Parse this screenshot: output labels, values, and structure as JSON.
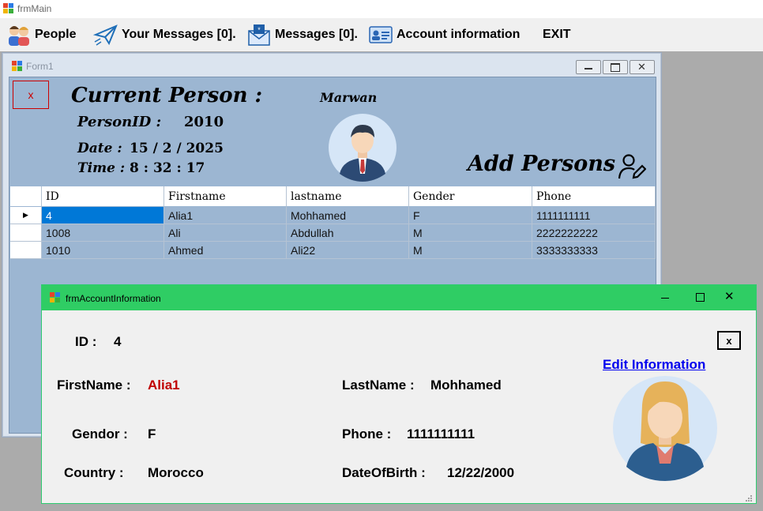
{
  "main_window": {
    "title": "frmMain"
  },
  "menu": {
    "people": "People",
    "your_messages": "Your Messages [0].",
    "messages": "Messages [0].",
    "account_information": "Account information",
    "exit": "EXIT"
  },
  "form1": {
    "title": "Form1",
    "close_label": "x",
    "current_person_label": "Current Person :",
    "person_id_label": "PersonID :",
    "person_id_value": "2010",
    "user_name": "Marwan",
    "date_label": "Date :",
    "date_value": "15 / 2 / 2025",
    "time_label": "Time :",
    "time_value": "8 : 32 : 17",
    "add_persons_label": "Add Persons"
  },
  "grid": {
    "columns": [
      "ID",
      "Firstname",
      "lastname",
      "Gender",
      "Phone"
    ],
    "rows": [
      [
        "4",
        "Alia1",
        "Mohhamed",
        "F",
        "1111111111"
      ],
      [
        "1008",
        "Ali",
        "Abdullah",
        "M",
        "2222222222"
      ],
      [
        "1010",
        "Ahmed",
        "Ali22",
        "M",
        "3333333333"
      ]
    ]
  },
  "account_window": {
    "title": "frmAccountInformation",
    "close_label": "x",
    "edit_link": "Edit Information",
    "id_label": "ID :",
    "id_value": "4",
    "firstname_label": "FirstName :",
    "firstname_value": "Alia1",
    "lastname_label": "LastName :",
    "lastname_value": "Mohhamed",
    "gender_label": "Gendor :",
    "gender_value": "F",
    "phone_label": "Phone :",
    "phone_value": "1111111111",
    "country_label": "Country :",
    "country_value": "Morocco",
    "dob_label": "DateOfBirth  :",
    "dob_value": "12/22/2000"
  },
  "colors": {
    "accent_green": "#2fcd64",
    "selection_blue": "#0078d7",
    "highlight_red": "#c00000",
    "link_blue": "#0000ee"
  },
  "icons": [
    "app-icon",
    "people-icon",
    "paper-plane-icon",
    "envelope-icon",
    "id-card-icon",
    "user-edit-icon",
    "male-avatar-icon",
    "female-avatar-icon"
  ]
}
